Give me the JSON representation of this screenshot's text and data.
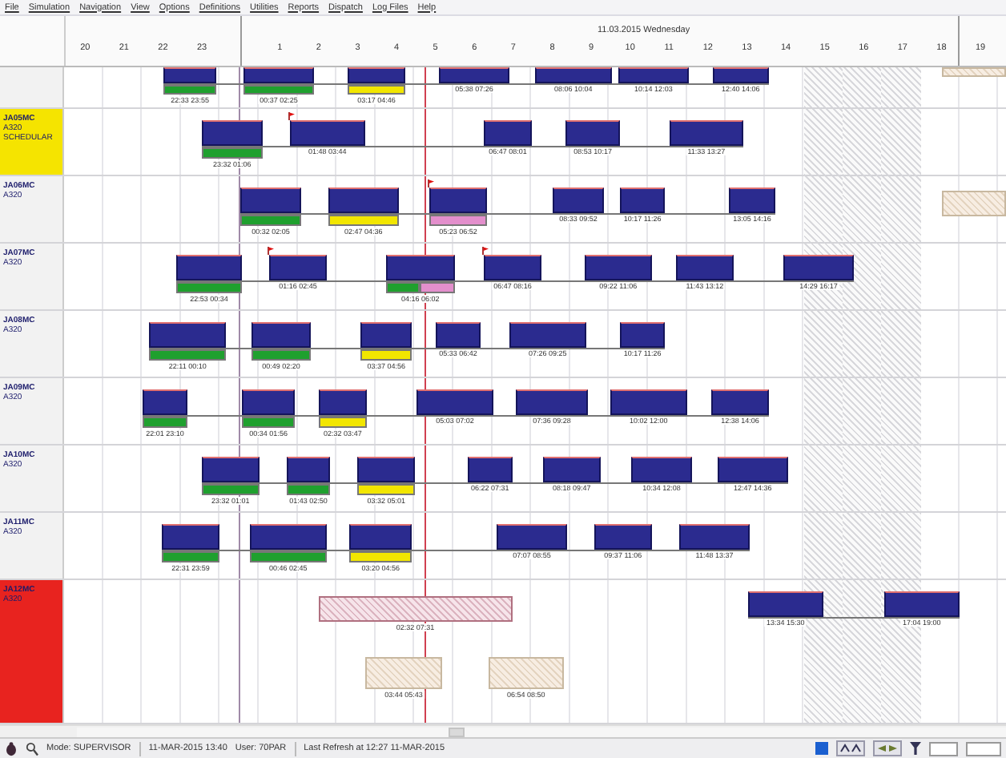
{
  "menu": [
    "File",
    "Simulation",
    "Navigation",
    "View",
    "Options",
    "Definitions",
    "Utilities",
    "Reports",
    "Dispatch",
    "Log Files",
    "Help"
  ],
  "header": {
    "date": "11.03.2015 Wednesday",
    "hours": [
      {
        "label": "20",
        "gap_after": false,
        "blocked": false
      },
      {
        "label": "21",
        "gap_after": false,
        "blocked": false
      },
      {
        "label": "22",
        "gap_after": false,
        "blocked": false
      },
      {
        "label": "23",
        "gap_after": true,
        "blocked": false
      },
      {
        "label": "1",
        "gap_after": false,
        "blocked": false
      },
      {
        "label": "2",
        "gap_after": false,
        "blocked": false
      },
      {
        "label": "3",
        "gap_after": false,
        "blocked": false
      },
      {
        "label": "4",
        "gap_after": false,
        "blocked": false
      },
      {
        "label": "5",
        "gap_after": false,
        "blocked": false
      },
      {
        "label": "6",
        "gap_after": false,
        "blocked": false
      },
      {
        "label": "7",
        "gap_after": false,
        "blocked": false
      },
      {
        "label": "8",
        "gap_after": false,
        "blocked": false
      },
      {
        "label": "9",
        "gap_after": false,
        "blocked": false
      },
      {
        "label": "10",
        "gap_after": false,
        "blocked": false
      },
      {
        "label": "11",
        "gap_after": false,
        "blocked": false
      },
      {
        "label": "12",
        "gap_after": false,
        "blocked": false
      },
      {
        "label": "13",
        "gap_after": false,
        "blocked": false
      },
      {
        "label": "14",
        "gap_after": false,
        "blocked": false
      },
      {
        "label": "15",
        "gap_after": false,
        "blocked": true
      },
      {
        "label": "16",
        "gap_after": false,
        "blocked": true
      },
      {
        "label": "17",
        "gap_after": false,
        "blocked": true
      },
      {
        "label": "18",
        "gap_after": false,
        "blocked": false
      },
      {
        "label": "19",
        "gap_after": false,
        "blocked": false
      }
    ]
  },
  "now_marker": {
    "level": 0.383
  },
  "rows": [
    {
      "color": "#f2f2f2",
      "items": [
        {
          "kind": "flight",
          "start": "22:33",
          "end": "23:55",
          "flag": false,
          "checks": [
            {
              "color": "#1fa02e"
            }
          ]
        },
        {
          "kind": "flight",
          "start": "00:37",
          "end": "02:25",
          "flag": false,
          "checks": [
            {
              "color": "#1fa02e"
            }
          ]
        },
        {
          "kind": "flight",
          "start": "03:17",
          "end": "04:46",
          "flag": false,
          "checks": [
            {
              "color": "#f2e600"
            }
          ]
        },
        {
          "kind": "flight",
          "start": "05:38",
          "end": "07:26",
          "flag": false
        },
        {
          "kind": "flight",
          "start": "08:06",
          "end": "10:04",
          "flag": false
        },
        {
          "kind": "flight",
          "start": "10:14",
          "end": "12:03",
          "flag": false
        },
        {
          "kind": "flight",
          "start": "12:40",
          "end": "14:06",
          "flag": false
        },
        {
          "kind": "standby",
          "at_edge": true,
          "lower": false
        }
      ]
    },
    {
      "registration": "JA05MC",
      "type": "A320",
      "status": "SCHEDULAR",
      "color": "#f5e400",
      "items": [
        {
          "kind": "flight",
          "start": "23:32",
          "end": "01:06",
          "flag": false,
          "checks": [
            {
              "color": "#1fa02e"
            }
          ]
        },
        {
          "kind": "flight",
          "start": "01:48",
          "end": "03:44",
          "flag": true
        },
        {
          "kind": "flight",
          "start": "06:47",
          "end": "08:01",
          "flag": false
        },
        {
          "kind": "flight",
          "start": "08:53",
          "end": "10:17",
          "flag": false
        },
        {
          "kind": "flight",
          "start": "11:33",
          "end": "13:27",
          "flag": false
        }
      ]
    },
    {
      "registration": "JA06MC",
      "type": "A320",
      "color": "#f2f2f2",
      "items": [
        {
          "kind": "flight",
          "start": "00:32",
          "end": "02:05",
          "flag": false,
          "checks": [
            {
              "color": "#1fa02e"
            }
          ]
        },
        {
          "kind": "flight",
          "start": "02:47",
          "end": "04:36",
          "flag": false,
          "checks": [
            {
              "color": "#f2e600"
            }
          ]
        },
        {
          "kind": "flight",
          "start": "05:23",
          "end": "06:52",
          "flag": true,
          "checks": [
            {
              "color": "#e38fcc"
            }
          ]
        },
        {
          "kind": "flight",
          "start": "08:33",
          "end": "09:52",
          "flag": false
        },
        {
          "kind": "flight",
          "start": "10:17",
          "end": "11:26",
          "flag": false
        },
        {
          "kind": "flight",
          "start": "13:05",
          "end": "14:16",
          "flag": false
        },
        {
          "kind": "standby",
          "at_edge": true,
          "lower": false
        }
      ]
    },
    {
      "registration": "JA07MC",
      "type": "A320",
      "color": "#f2f2f2",
      "items": [
        {
          "kind": "flight",
          "start": "22:53",
          "end": "00:34",
          "flag": false,
          "checks": [
            {
              "color": "#1fa02e"
            }
          ]
        },
        {
          "kind": "flight",
          "start": "01:16",
          "end": "02:45",
          "flag": true
        },
        {
          "kind": "flight",
          "start": "04:16",
          "end": "06:02",
          "flag": false,
          "checks": [
            {
              "color": "#1fa02e"
            },
            {
              "color": "#e38fcc"
            }
          ]
        },
        {
          "kind": "flight",
          "start": "06:47",
          "end": "08:16",
          "flag": true
        },
        {
          "kind": "flight",
          "start": "09:22",
          "end": "11:06",
          "flag": false
        },
        {
          "kind": "flight",
          "start": "11:43",
          "end": "13:12",
          "flag": false
        },
        {
          "kind": "flight",
          "start": "14:29",
          "end": "16:17",
          "flag": false
        }
      ]
    },
    {
      "registration": "JA08MC",
      "type": "A320",
      "color": "#f2f2f2",
      "items": [
        {
          "kind": "flight",
          "start": "22:11",
          "end": "00:10",
          "flag": false,
          "checks": [
            {
              "color": "#1fa02e"
            }
          ]
        },
        {
          "kind": "flight",
          "start": "00:49",
          "end": "02:20",
          "flag": false,
          "checks": [
            {
              "color": "#1fa02e"
            }
          ]
        },
        {
          "kind": "flight",
          "start": "03:37",
          "end": "04:56",
          "flag": false,
          "checks": [
            {
              "color": "#f2e600"
            }
          ]
        },
        {
          "kind": "flight",
          "start": "05:33",
          "end": "06:42",
          "flag": false
        },
        {
          "kind": "flight",
          "start": "07:26",
          "end": "09:25",
          "flag": false
        },
        {
          "kind": "flight",
          "start": "10:17",
          "end": "11:26",
          "flag": false
        }
      ]
    },
    {
      "registration": "JA09MC",
      "type": "A320",
      "color": "#f2f2f2",
      "items": [
        {
          "kind": "flight",
          "start": "22:01",
          "end": "23:10",
          "flag": false,
          "checks": [
            {
              "color": "#1fa02e"
            }
          ]
        },
        {
          "kind": "flight",
          "start": "00:34",
          "end": "01:56",
          "flag": false,
          "checks": [
            {
              "color": "#1fa02e"
            }
          ]
        },
        {
          "kind": "flight",
          "start": "02:32",
          "end": "03:47",
          "flag": false,
          "checks": [
            {
              "color": "#f2e600"
            }
          ]
        },
        {
          "kind": "flight",
          "start": "05:03",
          "end": "07:02",
          "flag": false
        },
        {
          "kind": "flight",
          "start": "07:36",
          "end": "09:28",
          "flag": false
        },
        {
          "kind": "flight",
          "start": "10:02",
          "end": "12:00",
          "flag": false
        },
        {
          "kind": "flight",
          "start": "12:38",
          "end": "14:06",
          "flag": false
        }
      ]
    },
    {
      "registration": "JA10MC",
      "type": "A320",
      "color": "#f2f2f2",
      "items": [
        {
          "kind": "flight",
          "start": "23:32",
          "end": "01:01",
          "flag": false,
          "checks": [
            {
              "color": "#1fa02e"
            }
          ]
        },
        {
          "kind": "flight",
          "start": "01:43",
          "end": "02:50",
          "flag": false,
          "checks": [
            {
              "color": "#1fa02e"
            }
          ]
        },
        {
          "kind": "flight",
          "start": "03:32",
          "end": "05:01",
          "flag": false,
          "checks": [
            {
              "color": "#f2e600"
            }
          ]
        },
        {
          "kind": "flight",
          "start": "06:22",
          "end": "07:31",
          "flag": false
        },
        {
          "kind": "flight",
          "start": "08:18",
          "end": "09:47",
          "flag": false
        },
        {
          "kind": "flight",
          "start": "10:34",
          "end": "12:08",
          "flag": false
        },
        {
          "kind": "flight",
          "start": "12:47",
          "end": "14:36",
          "flag": false
        }
      ]
    },
    {
      "registration": "JA11MC",
      "type": "A320",
      "color": "#f2f2f2",
      "items": [
        {
          "kind": "flight",
          "start": "22:31",
          "end": "23:59",
          "flag": false,
          "checks": [
            {
              "color": "#1fa02e"
            }
          ]
        },
        {
          "kind": "flight",
          "start": "00:46",
          "end": "02:45",
          "flag": false,
          "checks": [
            {
              "color": "#1fa02e"
            }
          ]
        },
        {
          "kind": "flight",
          "start": "03:20",
          "end": "04:56",
          "flag": false,
          "checks": [
            {
              "color": "#f2e600"
            }
          ]
        },
        {
          "kind": "flight",
          "start": "07:07",
          "end": "08:55",
          "flag": false
        },
        {
          "kind": "flight",
          "start": "09:37",
          "end": "11:06",
          "flag": false
        },
        {
          "kind": "flight",
          "start": "11:48",
          "end": "13:37",
          "flag": false
        }
      ]
    },
    {
      "registration": "JA12MC",
      "type": "A320",
      "color": "#e8231f",
      "items": [
        {
          "kind": "maintenance",
          "start": "02:32",
          "end": "07:31"
        },
        {
          "kind": "standby",
          "start": "03:44",
          "end": "05:43",
          "lower": true
        },
        {
          "kind": "standby",
          "start": "06:54",
          "end": "08:50",
          "lower": true
        },
        {
          "kind": "flight",
          "start": "13:34",
          "end": "15:30",
          "flag": false
        },
        {
          "kind": "flight",
          "start": "17:04",
          "end": "19:00",
          "flag": false
        }
      ]
    }
  ],
  "status_bar": {
    "mode": "Mode: SUPERVISOR",
    "datetime": "11-MAR-2015 13:40",
    "user": "User: 70PAR",
    "refresh": "Last Refresh at 12:27 11-MAR-2015"
  }
}
